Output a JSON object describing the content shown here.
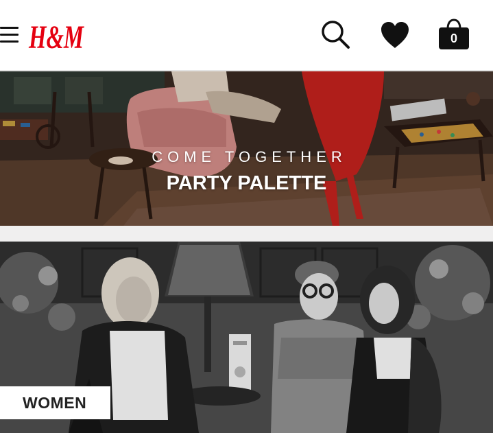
{
  "header": {
    "brand": "H&M",
    "cart_count": "0"
  },
  "hero": {
    "eyebrow": "COME TOGETHER",
    "title": "PARTY PALETTE"
  },
  "women": {
    "label": "WOMEN"
  },
  "colors": {
    "brand_red": "#e50010",
    "icon_black": "#111111",
    "header_border": "#e3e3e3",
    "gap_gray": "#f0efef"
  },
  "icons": {
    "menu": "hamburger-menu-icon",
    "search": "search-icon",
    "wishlist": "heart-icon",
    "cart": "shopping-bag-icon"
  }
}
